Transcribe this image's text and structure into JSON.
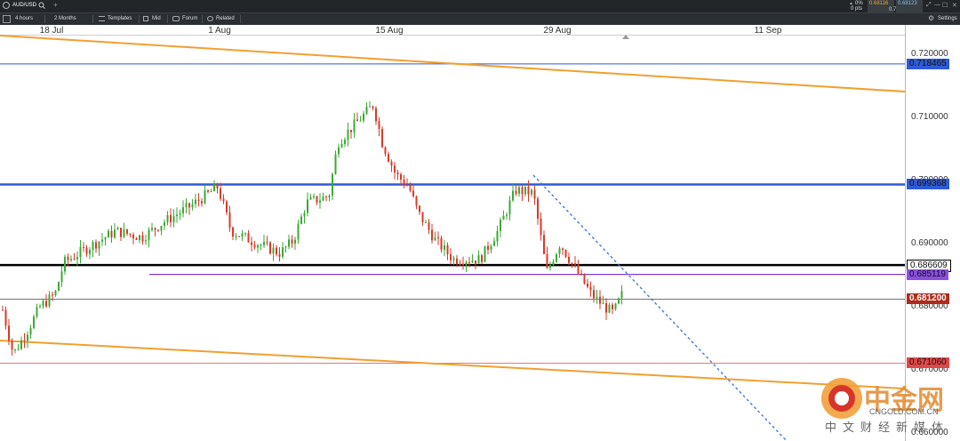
{
  "header": {
    "symbol": "AUD/USD",
    "add_tab": "+",
    "change_pct": "0%",
    "change_pts": "0 pts",
    "sell_price": "0.68116",
    "spread": "0.7",
    "buy_price": "0.68123",
    "window_controls": [
      "⤢",
      "—",
      "☐",
      "✕"
    ]
  },
  "toolbar": {
    "interval": "4 hours",
    "range": "2 Months",
    "templates": "Templates",
    "price_type": "Mid",
    "forum": "Forum",
    "related": "Related",
    "settings": "Settings"
  },
  "dates": [
    "18 Jul",
    "1 Aug",
    "15 Aug",
    "29 Aug",
    "11 Sep"
  ],
  "price_axis": {
    "ticks": [
      "0.720000",
      "0.710000",
      "0.700000",
      "0.690000",
      "0.680000",
      "0.670000",
      "0.660000"
    ],
    "range": [
      0.66,
      0.7225
    ]
  },
  "levels": [
    {
      "value": "0.718465",
      "color": "#2f5bd8",
      "tag_bg": "#2f5bd8",
      "tag_fg": "#111"
    },
    {
      "value": "0.699368",
      "color": "#2f5bd8",
      "tag_bg": "#2f5bd8",
      "tag_fg": "#111"
    },
    {
      "value": "0.686609",
      "color": "#000000",
      "tag_bg": "#ffffff",
      "tag_fg": "#111"
    },
    {
      "value": "0.685119",
      "color": "#7b3fd0",
      "tag_bg": "#8a4fe0",
      "tag_fg": "#111"
    },
    {
      "value": "0.681200",
      "color": "#444444",
      "tag_bg": "#b02a1a",
      "tag_fg": "#ffffff"
    },
    {
      "value": "0.671060",
      "color": "#e04848",
      "tag_bg": "#e04848",
      "tag_fg": "#111"
    }
  ],
  "colors": {
    "up": "#3aaa35",
    "down": "#d83a2a",
    "channel": "#f0a030",
    "trend": "#3a6fd8"
  },
  "watermark": {
    "brand": "中金网",
    "site": "CNGOLD.COM.CN",
    "tagline": "中文财经新媒体"
  }
}
